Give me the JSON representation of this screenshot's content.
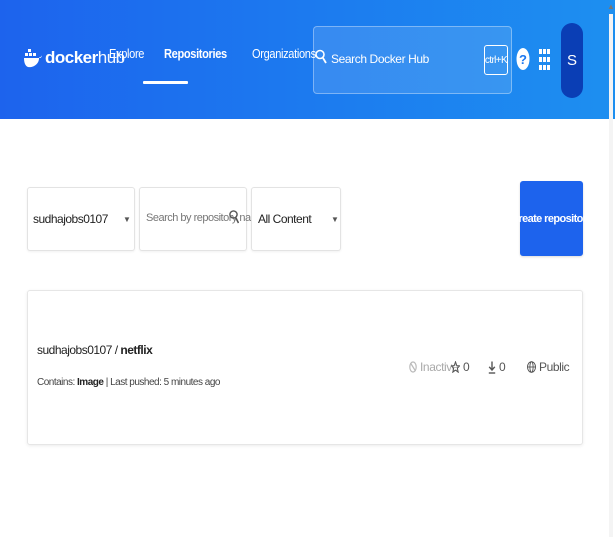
{
  "header": {
    "logo_bold": "docker",
    "logo_thin": "hub",
    "nav": [
      {
        "label": "Explore"
      },
      {
        "label": "Repositories"
      },
      {
        "label": "Organizations"
      }
    ],
    "search_placeholder": "Search Docker Hub",
    "shortcut": "ctrl+K",
    "avatar_initial": "S"
  },
  "filters": {
    "namespace": "sudhajobs0107",
    "search_placeholder": "Search by repository name",
    "content_filter": "All Content"
  },
  "actions": {
    "create_label": "Create repository"
  },
  "repo": {
    "namespace": "sudhajobs0107 / ",
    "name": "netflix",
    "contains_label": "Contains: ",
    "contains_value": "Image",
    "last_pushed": " | Last pushed: 5 minutes ago",
    "status": "Inactive",
    "stars": "0",
    "pulls": "0",
    "visibility": "Public"
  },
  "colors": {
    "brand_blue": "#1d63ed",
    "avatar_blue": "#0a3eb5"
  }
}
